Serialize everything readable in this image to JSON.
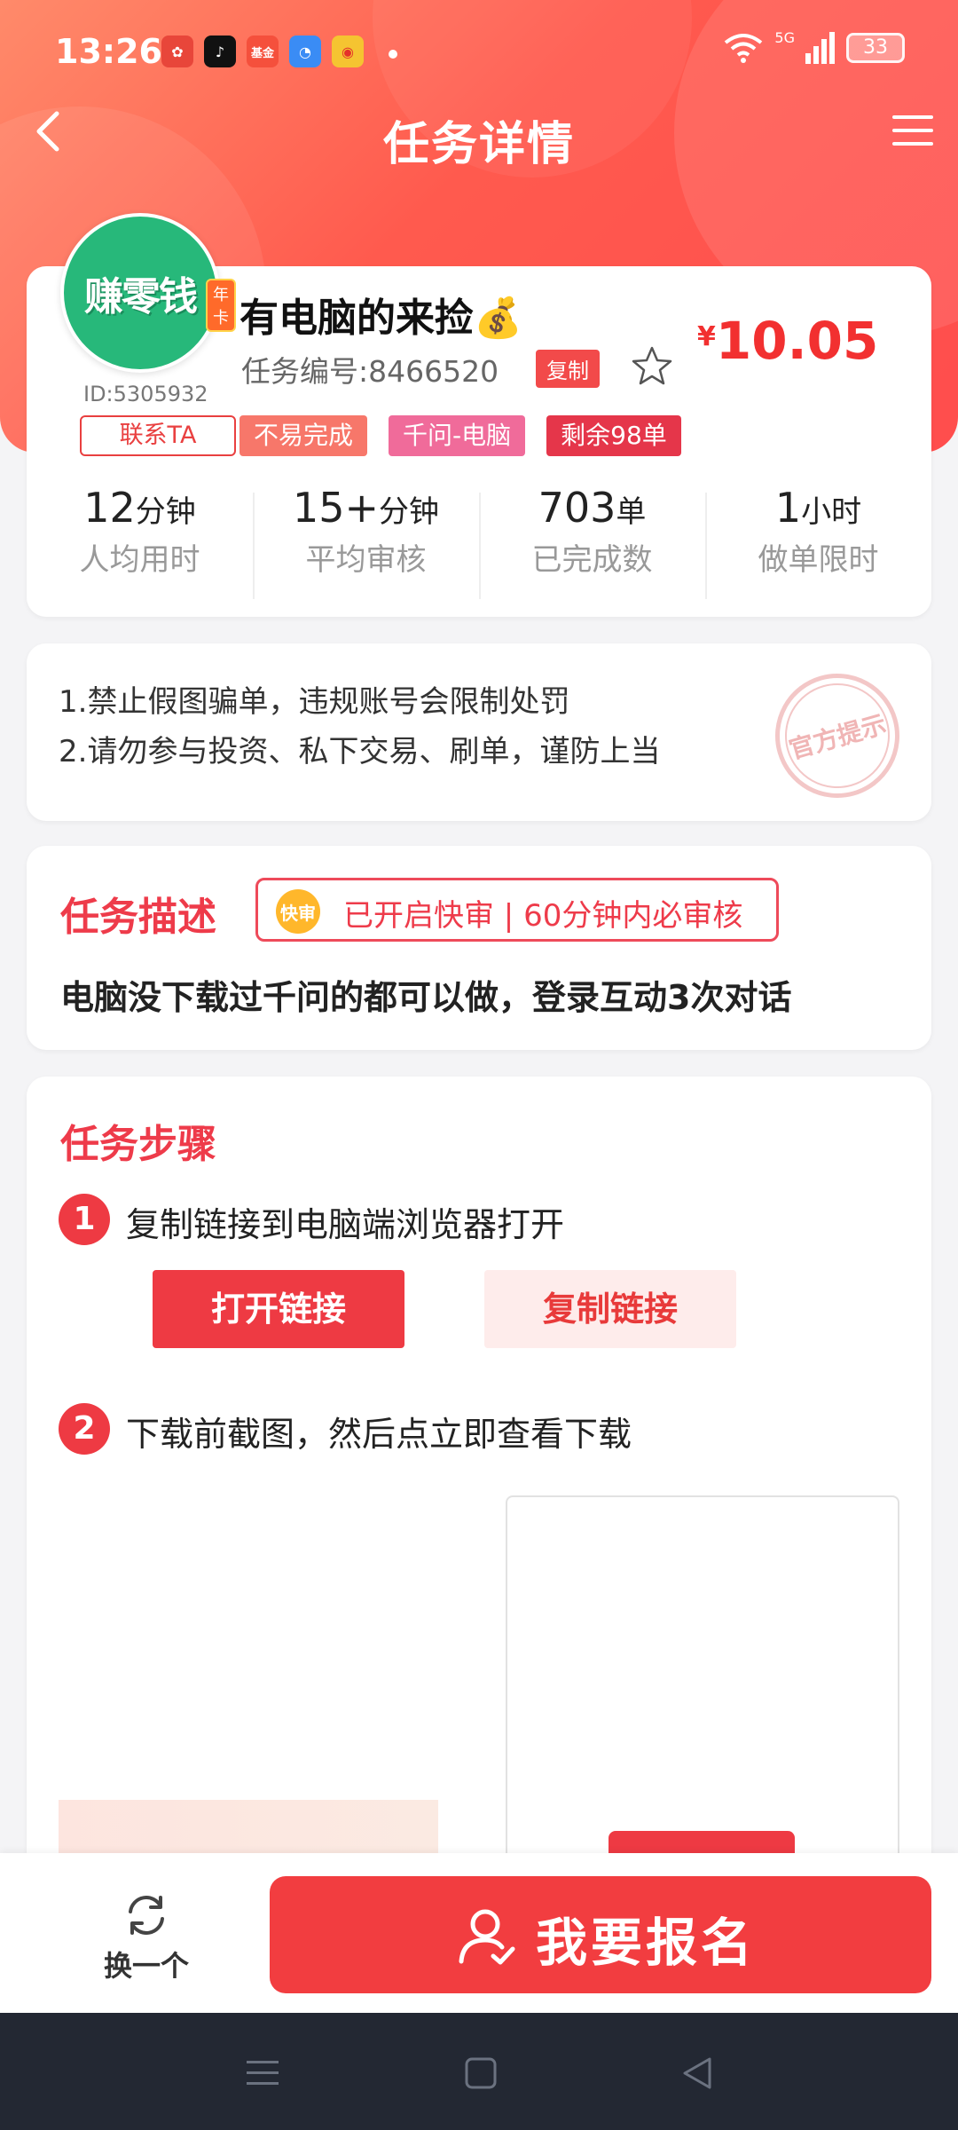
{
  "status_bar": {
    "time": "13:26",
    "network": "5G",
    "battery": "33",
    "app_icons": [
      "huawei-icon",
      "tiktok-icon",
      "fund-icon",
      "browser-icon",
      "weibo-icon"
    ],
    "fund_app_label": "基金"
  },
  "nav": {
    "title": "任务详情"
  },
  "task": {
    "avatar_text": "赚零钱",
    "annual_badge": "年卡",
    "user_id": "ID:5305932",
    "contact_label": "联系TA",
    "title": "有电脑的来捡💰",
    "task_no": "任务编号:8466520",
    "copy_label": "复制",
    "currency": "¥",
    "price": "10.05",
    "tags": [
      "不易完成",
      "千问-电脑",
      "剩余98单"
    ]
  },
  "stats": [
    {
      "value": "12",
      "unit": "分钟",
      "label": "人均用时"
    },
    {
      "value": "15+",
      "unit": "分钟",
      "label": "平均审核"
    },
    {
      "value": "703",
      "unit": "单",
      "label": "已完成数"
    },
    {
      "value": "1",
      "unit": "小时",
      "label": "做单限时"
    }
  ],
  "warnings": {
    "lines": [
      "1.禁止假图骗单，违规账号会限制处罚",
      "2.请勿参与投资、私下交易、刷单，谨防上当"
    ],
    "stamp": "官方提示"
  },
  "description": {
    "title": "任务描述",
    "fast_icon": "快审",
    "fast_text": "已开启快审 | 60分钟内必审核",
    "text": "电脑没下载过千问的都可以做，登录互动3次对话"
  },
  "steps": {
    "title": "任务步骤",
    "items": [
      {
        "num": "1",
        "text": "复制链接到电脑端浏览器打开"
      },
      {
        "num": "2",
        "text": "下载前截图，然后点立即查看下载"
      }
    ],
    "open_link": "打开链接",
    "copy_link": "复制链接"
  },
  "actions": {
    "switch_label": "换一个",
    "signup_label": "我要报名"
  },
  "colors": {
    "accent": "#f23d40",
    "header_start": "#ff8a6a",
    "header_end": "#ff4d4d"
  }
}
